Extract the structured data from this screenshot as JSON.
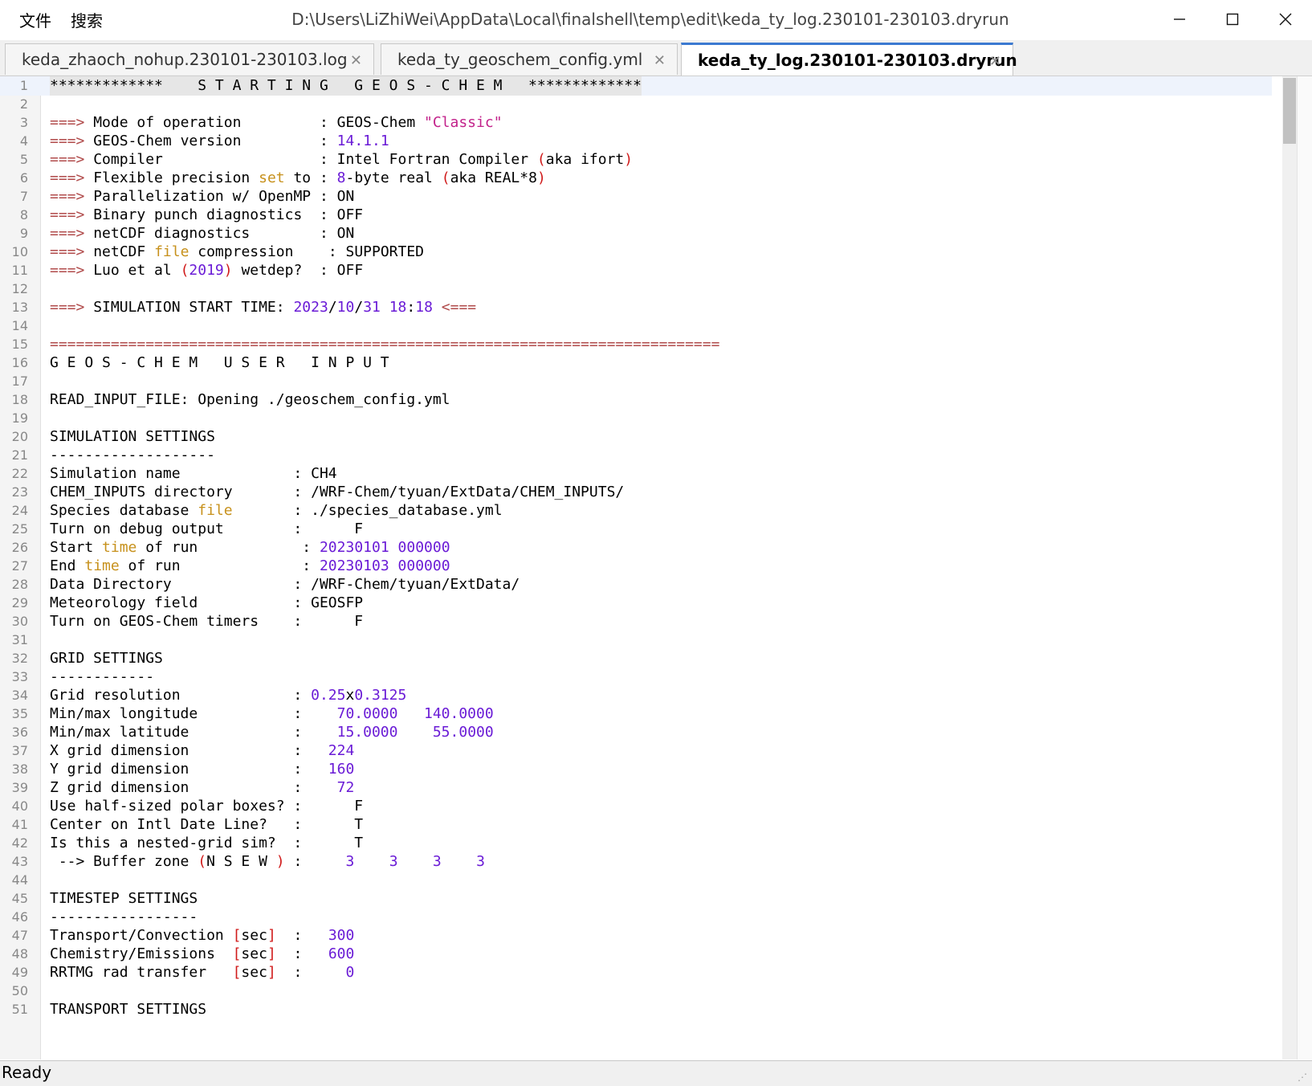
{
  "menu": {
    "file": "文件",
    "search": "搜索"
  },
  "window_title": "D:\\Users\\LiZhiWei\\AppData\\Local\\finalshell\\temp\\edit\\keda_ty_log.230101-230103.dryrun",
  "tabs": [
    {
      "label": "keda_zhaoch_nohup.230101-230103.log",
      "active": false
    },
    {
      "label": "keda_ty_geoschem_config.yml",
      "active": false
    },
    {
      "label": "keda_ty_log.230101-230103.dryrun",
      "active": true
    }
  ],
  "status": "Ready",
  "lines": [
    [
      [
        "*************    S T A R T I N G   G E O S - C H E M   *************",
        ""
      ]
    ],
    [],
    [
      [
        "===>",
        "kw"
      ],
      [
        " Mode of operation         : GEOS-Chem ",
        ""
      ],
      [
        "\"Classic\"",
        "str"
      ]
    ],
    [
      [
        "===>",
        "kw"
      ],
      [
        " GEOS-Chem version         : ",
        ""
      ],
      [
        "14.1.1",
        "num"
      ]
    ],
    [
      [
        "===>",
        "kw"
      ],
      [
        " Compiler                  : Intel Fortran Compiler ",
        ""
      ],
      [
        "(",
        "paren"
      ],
      [
        "aka ifort",
        ""
      ],
      [
        ")",
        "paren"
      ]
    ],
    [
      [
        "===>",
        "kw"
      ],
      [
        " Flexible precision ",
        ""
      ],
      [
        "set",
        "key"
      ],
      [
        " to : ",
        ""
      ],
      [
        "8",
        "num"
      ],
      [
        "-byte real ",
        ""
      ],
      [
        "(",
        "paren"
      ],
      [
        "aka REAL*8",
        ""
      ],
      [
        ")",
        "paren"
      ]
    ],
    [
      [
        "===>",
        "kw"
      ],
      [
        " Parallelization w/ OpenMP : ON",
        ""
      ]
    ],
    [
      [
        "===>",
        "kw"
      ],
      [
        " Binary punch diagnostics  : OFF",
        ""
      ]
    ],
    [
      [
        "===>",
        "kw"
      ],
      [
        " netCDF diagnostics        : ON",
        ""
      ]
    ],
    [
      [
        "===>",
        "kw"
      ],
      [
        " netCDF ",
        ""
      ],
      [
        "file",
        "key"
      ],
      [
        " compression    : SUPPORTED",
        ""
      ]
    ],
    [
      [
        "===>",
        "kw"
      ],
      [
        " Luo et al ",
        ""
      ],
      [
        "(",
        "paren"
      ],
      [
        "2019",
        "num"
      ],
      [
        ")",
        "paren"
      ],
      [
        " wetdep?  : OFF",
        ""
      ]
    ],
    [],
    [
      [
        "===>",
        "kw"
      ],
      [
        " SIMULATION START TIME: ",
        ""
      ],
      [
        "2023",
        "num"
      ],
      [
        "/",
        ""
      ],
      [
        "10",
        "num"
      ],
      [
        "/",
        ""
      ],
      [
        "31",
        "num"
      ],
      [
        " ",
        ""
      ],
      [
        "18",
        "num"
      ],
      [
        ":",
        ""
      ],
      [
        "18",
        "num"
      ],
      [
        " ",
        ""
      ],
      [
        "<===",
        "kw"
      ]
    ],
    [],
    [
      [
        "=============================================================================",
        "kw"
      ]
    ],
    [
      [
        "G E O S - C H E M   U S E R   I N P U T",
        ""
      ]
    ],
    [],
    [
      [
        "READ_INPUT_FILE: Opening ./geoschem_config.yml",
        ""
      ]
    ],
    [],
    [
      [
        "SIMULATION SETTINGS",
        ""
      ]
    ],
    [
      [
        "-------------------",
        ""
      ]
    ],
    [
      [
        "Simulation name             : CH4",
        ""
      ]
    ],
    [
      [
        "CHEM_INPUTS directory       : /WRF-Chem/tyuan/ExtData/CHEM_INPUTS/",
        ""
      ]
    ],
    [
      [
        "Species database ",
        ""
      ],
      [
        "file",
        "key"
      ],
      [
        "       : ./species_database.yml",
        ""
      ]
    ],
    [
      [
        "Turn on debug output        :      F",
        ""
      ]
    ],
    [
      [
        "Start ",
        ""
      ],
      [
        "time",
        "key"
      ],
      [
        " of run            : ",
        ""
      ],
      [
        "20230101",
        "num"
      ],
      [
        " ",
        ""
      ],
      [
        "000000",
        "num"
      ]
    ],
    [
      [
        "End ",
        ""
      ],
      [
        "time",
        "key"
      ],
      [
        " of run              : ",
        ""
      ],
      [
        "20230103",
        "num"
      ],
      [
        " ",
        ""
      ],
      [
        "000000",
        "num"
      ]
    ],
    [
      [
        "Data Directory              : /WRF-Chem/tyuan/ExtData/",
        ""
      ]
    ],
    [
      [
        "Meteorology field           : GEOSFP",
        ""
      ]
    ],
    [
      [
        "Turn on GEOS-Chem timers    :      F",
        ""
      ]
    ],
    [],
    [
      [
        "GRID SETTINGS",
        ""
      ]
    ],
    [
      [
        "------------",
        ""
      ]
    ],
    [
      [
        "Grid resolution             : ",
        ""
      ],
      [
        "0.25",
        "num"
      ],
      [
        "x",
        ""
      ],
      [
        "0.3125",
        "num"
      ]
    ],
    [
      [
        "Min/max longitude           :    ",
        ""
      ],
      [
        "70.0000",
        "num"
      ],
      [
        "   ",
        ""
      ],
      [
        "140.0000",
        "num"
      ]
    ],
    [
      [
        "Min/max latitude            :    ",
        ""
      ],
      [
        "15.0000",
        "num"
      ],
      [
        "    ",
        ""
      ],
      [
        "55.0000",
        "num"
      ]
    ],
    [
      [
        "X grid dimension            :   ",
        ""
      ],
      [
        "224",
        "num"
      ]
    ],
    [
      [
        "Y grid dimension            :   ",
        ""
      ],
      [
        "160",
        "num"
      ]
    ],
    [
      [
        "Z grid dimension            :    ",
        ""
      ],
      [
        "72",
        "num"
      ]
    ],
    [
      [
        "Use half-sized polar boxes? :      F",
        ""
      ]
    ],
    [
      [
        "Center on Intl Date Line?   :      T",
        ""
      ]
    ],
    [
      [
        "Is this a nested-grid sim?  :      T",
        ""
      ]
    ],
    [
      [
        " --> Buffer zone ",
        ""
      ],
      [
        "(",
        "paren"
      ],
      [
        "N S E W ",
        ""
      ],
      [
        ")",
        "paren"
      ],
      [
        " :     ",
        ""
      ],
      [
        "3",
        "num"
      ],
      [
        "    ",
        ""
      ],
      [
        "3",
        "num"
      ],
      [
        "    ",
        ""
      ],
      [
        "3",
        "num"
      ],
      [
        "    ",
        ""
      ],
      [
        "3",
        "num"
      ]
    ],
    [],
    [
      [
        "TIMESTEP SETTINGS",
        ""
      ]
    ],
    [
      [
        "-----------------",
        ""
      ]
    ],
    [
      [
        "Transport/Convection ",
        ""
      ],
      [
        "[",
        "paren"
      ],
      [
        "sec",
        ""
      ],
      [
        "]",
        "paren"
      ],
      [
        "  :   ",
        ""
      ],
      [
        "300",
        "num"
      ]
    ],
    [
      [
        "Chemistry/Emissions  ",
        ""
      ],
      [
        "[",
        "paren"
      ],
      [
        "sec",
        ""
      ],
      [
        "]",
        "paren"
      ],
      [
        "  :   ",
        ""
      ],
      [
        "600",
        "num"
      ]
    ],
    [
      [
        "RRTMG rad transfer   ",
        ""
      ],
      [
        "[",
        "paren"
      ],
      [
        "sec",
        ""
      ],
      [
        "]",
        "paren"
      ],
      [
        "  :     ",
        ""
      ],
      [
        "0",
        "num"
      ]
    ],
    [],
    [
      [
        "TRANSPORT SETTINGS",
        ""
      ]
    ]
  ]
}
